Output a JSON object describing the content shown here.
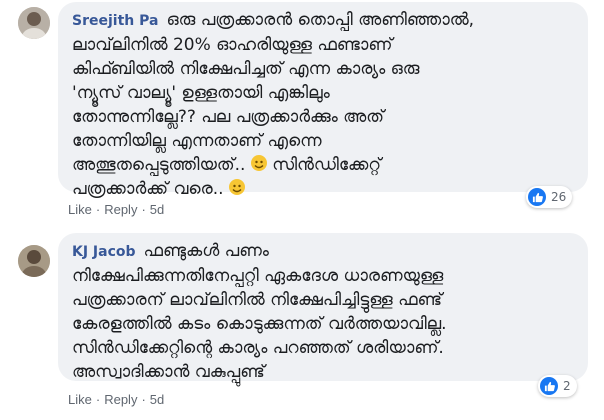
{
  "comments": [
    {
      "author": "Sreejith Pa",
      "text": "ഒരു പത്രക്കാരൻ തൊപ്പി അണിഞ്ഞാൽ,\nലാവ്‌ലിനിൽ 20% ഓഹരിയുള്ള ഫണ്ടാണ്\nകിഫ്ബിയിൽ നിക്ഷേപിച്ചത് എന്ന കാര്യം ഒരു\n'ന്യൂസ് വാല്യൂ' ഉള്ളതായി എങ്കിലും\nതോന്നുന്നില്ലേ?? പല പത്രക്കാർക്കും അത്\nതോന്നിയില്ല എന്നതാണ് എന്നെ\nഅത്ഭുതപ്പെടുത്തിയത്..",
      "text_tail_1": " സിൻഡിക്കേറ്റ്",
      "text_line_last": "പത്രക്കാർക്ക് വരെ..",
      "reaction_count": "26",
      "like_label": "Like",
      "reply_label": "Reply",
      "time": "5d",
      "separator": "·"
    },
    {
      "author": "KJ Jacob",
      "text_first": "ഫണ്ടുകൾ പണം",
      "text": "നിക്ഷേപിക്കുന്നതിനേപ്പറ്റി ഏകദേശ ധാരണയുള്ള\nപത്രക്കാരന് ലാവ്‌ലിനിൽ നിക്ഷേപിച്ചിട്ടുള്ള ഫണ്ട്\nകേരളത്തിൽ കടം കൊടുക്കുന്നത് വർത്തയാവില്ല.\nസിൻഡിക്കേറ്റിന്റെ കാര്യം പറഞ്ഞത് ശരിയാണ്.\nഅസ്വാദിക്കാൻ വകുപ്പുണ്ട്",
      "reaction_count": "2",
      "like_label": "Like",
      "reply_label": "Reply",
      "time": "5d",
      "separator": "·"
    }
  ],
  "colors": {
    "author": "#385898",
    "bubble": "#eff1f4",
    "like": "#1877f2"
  },
  "icons": {
    "reaction": "thumbs-up-icon",
    "emoji": "smiley-emoji-icon"
  }
}
